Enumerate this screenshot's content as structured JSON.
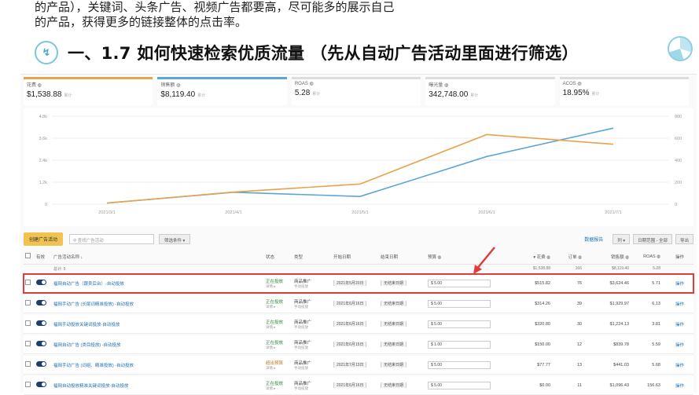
{
  "intro_lines": [
    "的产品），关键词、头条广告、视频广告都要高，尽可能多的展示自己",
    "的产品，获得更多的链接整体的点击率。"
  ],
  "slide_title": "一、1.7 如何快速检索优质流量 （先从自动广告活动里面进行筛选）",
  "metrics": [
    {
      "label": "花费 ◍",
      "value": "$1,538.88",
      "note": "累计"
    },
    {
      "label": "销售额 ◍",
      "value": "$8,119.40",
      "note": "累计"
    },
    {
      "label": "ROAS ◍",
      "value": "5.28",
      "note": "累计"
    },
    {
      "label": "曝光量 ◍",
      "value": "342,748.00",
      "note": "累计"
    },
    {
      "label": "ACOS ◍",
      "value": "18.95%",
      "note": "累计"
    }
  ],
  "chart_data": {
    "type": "line",
    "x": [
      "2021/3/1",
      "2021/4/1",
      "2021/5/1",
      "2021/6/1",
      "2021/7/1"
    ],
    "left_ticks": [
      "0",
      "1.2k",
      "2.4k",
      "3.6k",
      "4.8k"
    ],
    "right_ticks": [
      "0",
      "200",
      "400",
      "600",
      "800"
    ],
    "series": [
      {
        "color": "#5aa6d6",
        "axis": "left",
        "values": [
          60,
          650,
          420,
          2600,
          4150
        ]
      },
      {
        "color": "#e8a24a",
        "axis": "left",
        "values": [
          60,
          660,
          1100,
          3800,
          3270
        ]
      }
    ],
    "ylim": [
      0,
      4800
    ]
  },
  "toolbar": {
    "create": "创建广告活动",
    "search_placeholder": "查找广告活动",
    "filter": "筛选条件 ▾",
    "link": "数据报告",
    "col_btn": "列 ▾",
    "date_btn": "日期范围 - 全部",
    "export": "导出"
  },
  "columns": {
    "toggle": "有效",
    "name": "广告活动名称 ↓",
    "status": "状态",
    "type": "类型",
    "start": "开始日期",
    "end": "结束日期",
    "budget": "预算 ◍",
    "spend": "▾ 花费 ◍",
    "orders": "订单 ◍",
    "sales": "销售额 ◍",
    "roas": "ROAS ◍",
    "more": "操作"
  },
  "totals": {
    "label": "总计: 5",
    "spend": "$1,538.88",
    "orders": "166",
    "sales": "$8,119.40",
    "roas": "5.28"
  },
  "rows": [
    {
      "name": "福岡自动广告（跟卖后台）-自动投放",
      "status": "正在投放",
      "status_sub": "详情 ▸",
      "type": "商品推广",
      "type_sub": "手动投放",
      "start": "2021年5月20日",
      "end": "无结束日期",
      "budget": "5.00",
      "spend": "$515.82",
      "orders": "76",
      "sales": "$3,624.46",
      "roas": "5.71",
      "more": "操作",
      "status_color": "green"
    },
    {
      "name": "福岡手动广告 (长尾词精准投放) -自动投放",
      "status": "正在投放",
      "status_sub": "详情 ▸",
      "type": "商品推广",
      "type_sub": "手动投放",
      "start": "2021年6月16日",
      "end": "无结束日期",
      "budget": "5.00",
      "spend": "$314.26",
      "orders": "39",
      "sales": "$1,929.97",
      "roas": "6.13",
      "more": "操作",
      "status_color": "green"
    },
    {
      "name": "福岡手动投放关键词投放-自动投放",
      "status": "正在投放",
      "status_sub": "详情 ▸",
      "type": "商品推广",
      "type_sub": "手动投放",
      "start": "2021年6月16日",
      "end": "无结束日期",
      "budget": "5.00",
      "spend": "$320.80",
      "orders": "30",
      "sales": "$1,224.13",
      "roas": "3.81",
      "more": "操作",
      "status_color": "green"
    },
    {
      "name": "福岡自动广告 (类目投放) -自动投放",
      "status": "正在投放",
      "status_sub": "详情 ▸",
      "type": "商品推广",
      "type_sub": "手动投放",
      "start": "2021年6月15日",
      "end": "无结束日期",
      "budget": "1.00",
      "spend": "$150.00",
      "orders": "12",
      "sales": "$839.78",
      "roas": "5.59",
      "more": "操作",
      "status_color": "green"
    },
    {
      "name": "福岡手动广告 (词组、精准投放) -自动投放",
      "status": "超出预算",
      "status_sub": "详情 ▸",
      "type": "商品推广",
      "type_sub": "手动投放",
      "start": "2021年7月13日",
      "end": "无结束日期",
      "budget": "5.00",
      "spend": "$77.77",
      "orders": "13",
      "sales": "$441.03",
      "roas": "5.68",
      "more": "操作",
      "status_color": "amber"
    },
    {
      "name": "福岡自动投放精准关键词投放-自动投放",
      "status": "正在投放",
      "status_sub": "详情 ▸",
      "type": "商品推广",
      "type_sub": "手动投放",
      "start": "2021年6月16日",
      "end": "无结束日期",
      "budget": "5.00",
      "spend": "$0.00",
      "orders": "11",
      "sales": "$1,096.43",
      "roas": "156.63",
      "more": "操作",
      "status_color": "green"
    }
  ]
}
